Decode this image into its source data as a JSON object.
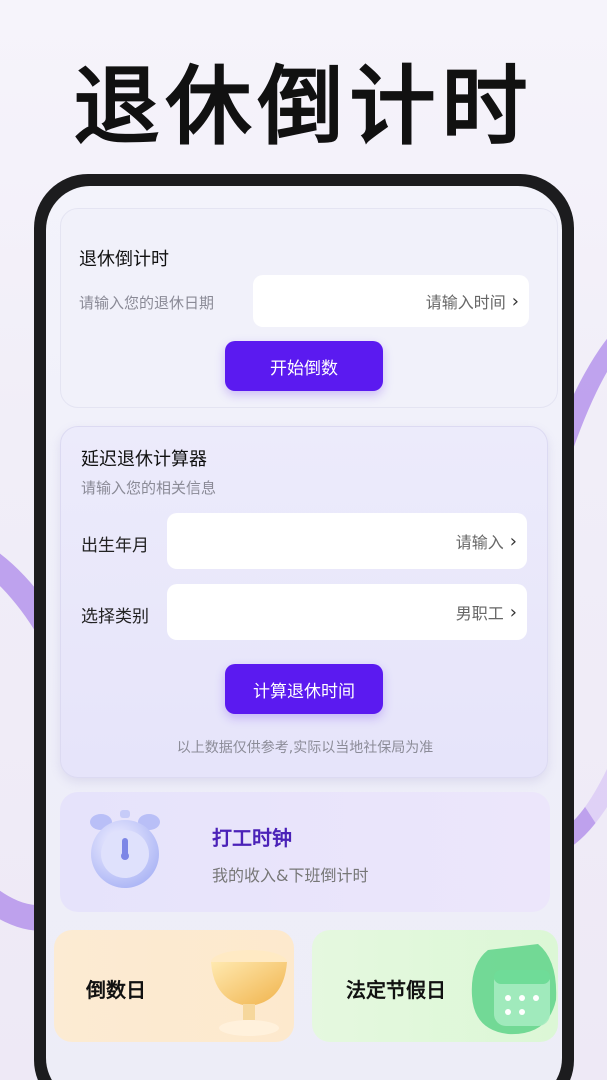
{
  "promo": {
    "title": "退休倒计时"
  },
  "countdown_card": {
    "title": "退休倒计时",
    "prompt": "请输入您的退休日期",
    "date_field_placeholder": "请输入时间",
    "start_button": "开始倒数"
  },
  "delay_card": {
    "title": "延迟退休计算器",
    "subtitle": "请输入您的相关信息",
    "birth_label": "出生年月",
    "birth_placeholder": "请输入",
    "category_label": "选择类别",
    "category_value": "男职工",
    "calc_button": "计算退休时间",
    "disclaimer": "以上数据仅供参考,实际以当地社保局为准"
  },
  "work_clock_card": {
    "title": "打工时钟",
    "subtitle": "我的收入&下班倒计时",
    "icon": "alarm-clock-icon"
  },
  "tiles": {
    "days_label": "倒数日",
    "days_icon": "trophy-cup-icon",
    "holiday_label": "法定节假日",
    "holiday_icon": "calendar-icon"
  },
  "colors": {
    "accent": "#5b1af0",
    "clock_title": "#4b22b8"
  }
}
